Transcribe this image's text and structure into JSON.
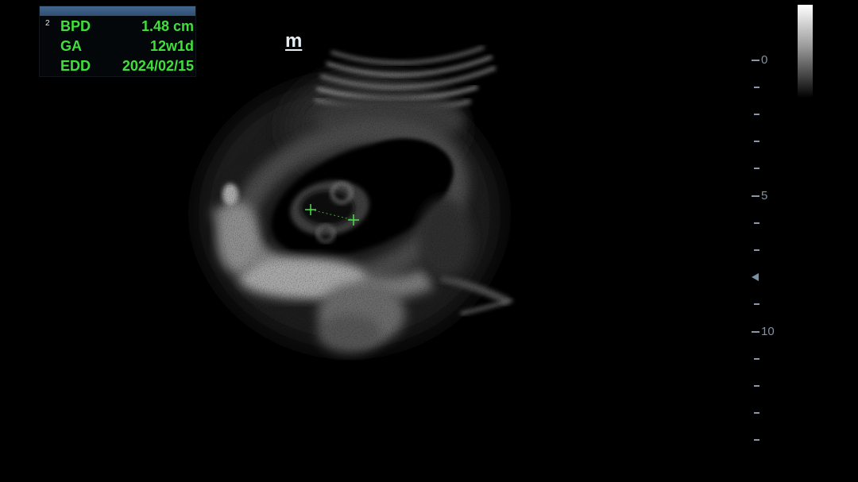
{
  "measurements": {
    "index": "2",
    "rows": [
      {
        "label": "BPD",
        "value": "1.48 cm"
      },
      {
        "label": "GA",
        "value": "12w1d"
      },
      {
        "label": "EDD",
        "value": "2024/02/15"
      }
    ]
  },
  "probe_marker": "m",
  "depth_scale": {
    "labels": [
      "0",
      "5",
      "10"
    ]
  },
  "icons": {
    "focus": "focus-depth-marker-icon",
    "caliper": "caliper-cross-icon"
  },
  "colors": {
    "measurement_text": "#3fe03a",
    "panel_header": "#3a5a80",
    "scale": "#8392a4",
    "background": "#000000"
  }
}
